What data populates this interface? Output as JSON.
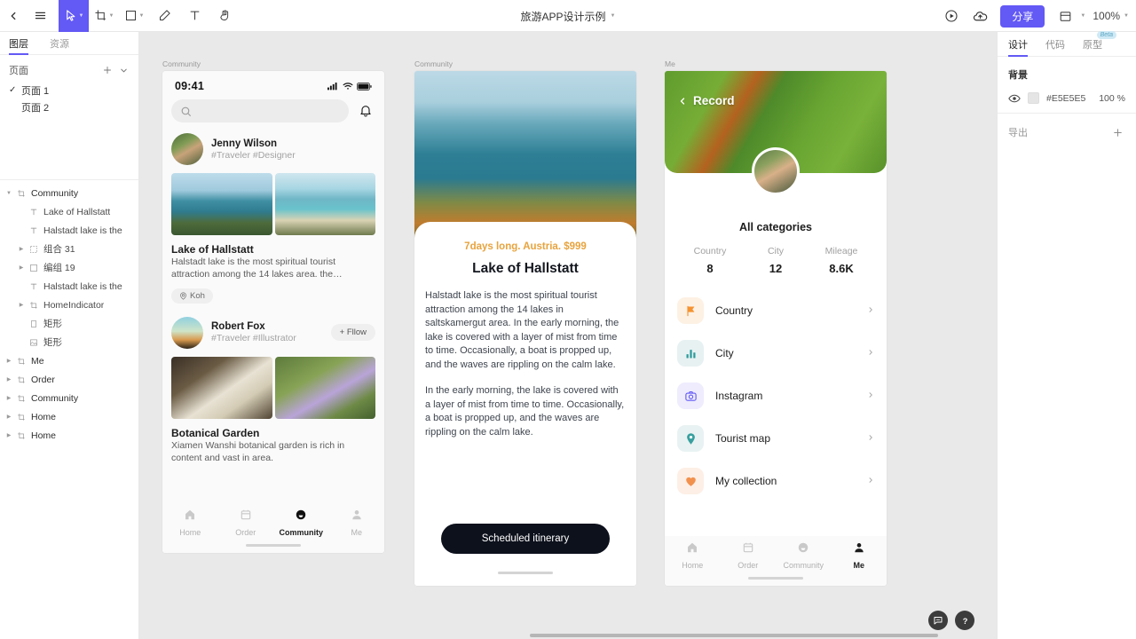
{
  "toolbar": {
    "back_icon": "chevron-left-icon",
    "menu_icon": "hamburger-icon",
    "tools": [
      {
        "name": "move-tool",
        "icon": "cursor-icon",
        "active": true,
        "has_caret": true
      },
      {
        "name": "frame-tool",
        "icon": "frame-icon",
        "active": false,
        "has_caret": true
      },
      {
        "name": "shape-tool",
        "icon": "square-icon",
        "active": false,
        "has_caret": true
      },
      {
        "name": "pen-tool",
        "icon": "pen-icon",
        "active": false,
        "has_caret": false
      },
      {
        "name": "text-tool",
        "icon": "text-icon",
        "active": false,
        "has_caret": false
      },
      {
        "name": "hand-tool",
        "icon": "hand-icon",
        "active": false,
        "has_caret": false
      }
    ],
    "title": "旅游APP设计示例",
    "present_icon": "play-circle-icon",
    "cloud_icon": "cloud-upload-icon",
    "share_label": "分享",
    "layout_icon": "layout-icon",
    "zoom_level": "100%",
    "accent_color": "#6359f5"
  },
  "left_panel": {
    "tabs": [
      {
        "label": "图层",
        "active": true
      },
      {
        "label": "资源",
        "active": false
      }
    ],
    "pages_header": "页面",
    "pages": [
      {
        "label": "页面 1",
        "checked": true
      },
      {
        "label": "页面 2",
        "checked": false
      }
    ],
    "layers": [
      {
        "label": "Community",
        "indent": 0,
        "icon": "frame-icon",
        "expanded": true,
        "bold": true
      },
      {
        "label": "Lake of Hallstatt",
        "indent": 1,
        "icon": "text-icon",
        "expanded": false,
        "bold": false
      },
      {
        "label": "Halstadt lake is the",
        "indent": 1,
        "icon": "text-icon",
        "expanded": false,
        "bold": false
      },
      {
        "label": "组合 31",
        "indent": 1,
        "icon": "group-icon",
        "expanded": false,
        "bold": false,
        "has_arrow": true
      },
      {
        "label": "编组 19",
        "indent": 1,
        "icon": "square-icon",
        "expanded": false,
        "bold": false,
        "has_arrow": true
      },
      {
        "label": "Halstadt lake is the",
        "indent": 1,
        "icon": "text-icon",
        "expanded": false,
        "bold": false
      },
      {
        "label": "HomeIndicator",
        "indent": 1,
        "icon": "frame-icon",
        "expanded": false,
        "bold": false,
        "has_arrow": true
      },
      {
        "label": "矩形",
        "indent": 1,
        "icon": "rect-icon",
        "expanded": false,
        "bold": false
      },
      {
        "label": "矩形",
        "indent": 1,
        "icon": "image-icon",
        "expanded": false,
        "bold": false
      },
      {
        "label": "Me",
        "indent": 0,
        "icon": "frame-icon",
        "expanded": false,
        "bold": true,
        "has_arrow": true
      },
      {
        "label": "Order",
        "indent": 0,
        "icon": "frame-icon",
        "expanded": false,
        "bold": true,
        "has_arrow": true
      },
      {
        "label": "Community",
        "indent": 0,
        "icon": "frame-icon",
        "expanded": false,
        "bold": true,
        "has_arrow": true
      },
      {
        "label": "Home",
        "indent": 0,
        "icon": "frame-icon",
        "expanded": false,
        "bold": true,
        "has_arrow": true
      },
      {
        "label": "Home",
        "indent": 0,
        "icon": "frame-icon",
        "expanded": false,
        "bold": true,
        "has_arrow": true
      }
    ]
  },
  "right_panel": {
    "tabs": [
      {
        "label": "设计",
        "active": true,
        "badge": null
      },
      {
        "label": "代码",
        "active": false,
        "badge": null
      },
      {
        "label": "原型",
        "active": false,
        "badge": "Beta"
      }
    ],
    "background_header": "背景",
    "background_hex": "#E5E5E5",
    "background_opacity": "100 %",
    "eye_icon": "eye-icon",
    "export_label": "导出",
    "export_add_icon": "plus-icon"
  },
  "canvas": {
    "background_color": "#E9E9E9",
    "frames": [
      {
        "label": "Community"
      },
      {
        "label": "Community"
      },
      {
        "label": "Me"
      }
    ]
  },
  "phone1": {
    "status_time": "09:41",
    "signal_icon": "signal-icon",
    "wifi_icon": "wifi-icon",
    "battery_icon": "battery-icon",
    "search_icon": "search-icon",
    "search_placeholder": "",
    "bell_icon": "bell-icon",
    "posts": [
      {
        "user": "Jenny Wilson",
        "tags": "#Traveler  #Designer",
        "title": "Lake of Hallstatt",
        "text": "Halstadt lake is the most spiritual tourist attraction among the 14 lakes  area. the…",
        "chip": "Koh",
        "chip_icon": "location-pin-icon",
        "follow": null
      },
      {
        "user": "Robert Fox",
        "tags": "#Traveler #Illustrator",
        "title": "Botanical Garden",
        "text": "Xiamen Wanshi botanical garden is rich in content and vast in area.",
        "chip": null,
        "follow": "+ Fllow"
      }
    ],
    "tabs": [
      {
        "label": "Home",
        "icon": "home-icon",
        "active": false
      },
      {
        "label": "Order",
        "icon": "order-icon",
        "active": false
      },
      {
        "label": "Community",
        "icon": "community-icon",
        "active": true
      },
      {
        "label": "Me",
        "icon": "person-icon",
        "active": false
      }
    ]
  },
  "phone2": {
    "price": "7days long. Austria. $999",
    "price_color": "#e8a33d",
    "title": "Lake of Hallstatt",
    "paragraph1": "Halstadt lake is the most spiritual tourist attraction among the 14 lakes in saltskamergut area. In the early morning, the lake is covered with a layer of mist from time to time. Occasionally, a boat is propped up, and the waves are rippling on the calm lake.",
    "paragraph2": "In the early morning, the lake is covered with a layer of mist from time to time. Occasionally, a boat is propped up, and the waves are rippling on the calm lake.",
    "cta_label": "Scheduled itinerary"
  },
  "phone3": {
    "back_label": "Record",
    "back_icon": "chevron-left-icon",
    "avatar": "user-avatar",
    "all_categories": "All categories",
    "stats": [
      {
        "key": "Country",
        "value": "8"
      },
      {
        "key": "City",
        "value": "12"
      },
      {
        "key": "Mileage",
        "value": "8.6K"
      }
    ],
    "menu": [
      {
        "label": "Country",
        "icon": "flag-icon",
        "icon_color": "#f59331",
        "bg": "#fdf1e4"
      },
      {
        "label": "City",
        "icon": "bar-chart-icon",
        "icon_color": "#2e9a9a",
        "bg": "#e7f1f2"
      },
      {
        "label": "Instagram",
        "icon": "camera-icon",
        "icon_color": "#6359f5",
        "bg": "#eeecfd"
      },
      {
        "label": "Tourist map",
        "icon": "map-pin-icon",
        "icon_color": "#2e9a9a",
        "bg": "#e9f2f2"
      },
      {
        "label": "My collection",
        "icon": "heart-icon",
        "icon_color": "#f2914e",
        "bg": "#fdefe6"
      }
    ],
    "chevron_icon": "chevron-right-icon",
    "tabs": [
      {
        "label": "Home",
        "icon": "home-icon",
        "active": false
      },
      {
        "label": "Order",
        "icon": "order-icon",
        "active": false
      },
      {
        "label": "Community",
        "icon": "community-icon",
        "active": false
      },
      {
        "label": "Me",
        "icon": "person-icon",
        "active": true
      }
    ]
  },
  "fabs": [
    {
      "name": "feedback-fab",
      "icon": "message-icon"
    },
    {
      "name": "help-fab",
      "icon": "question-icon"
    }
  ]
}
